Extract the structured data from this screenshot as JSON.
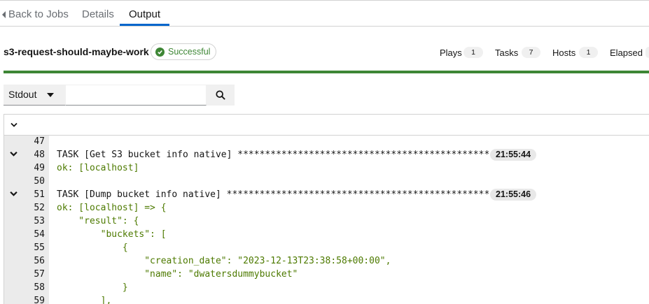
{
  "tabs": [
    {
      "label": "Back to Jobs"
    },
    {
      "label": "Details"
    },
    {
      "label": "Output"
    }
  ],
  "job": {
    "name": "s3-request-should-maybe-work",
    "status": "Successful"
  },
  "stats": [
    {
      "label": "Plays",
      "value": "1"
    },
    {
      "label": "Tasks",
      "value": "7"
    },
    {
      "label": "Hosts",
      "value": "1"
    },
    {
      "label": "Elapsed",
      "value": ""
    }
  ],
  "progress_fraction": 1.0,
  "colors": {
    "success": "#3e8635",
    "accent": "#0066cc",
    "ok_text": "#4d7a00"
  },
  "filter": {
    "selected": "Stdout",
    "search_value": "",
    "search_placeholder": ""
  },
  "output_lines": [
    {
      "num": "47",
      "text": "",
      "kind": "ok",
      "collapsible": false,
      "ts": ""
    },
    {
      "num": "48",
      "text": "TASK [Get S3 bucket info native] **********************************************",
      "kind": "task",
      "collapsible": true,
      "ts": "21:55:44"
    },
    {
      "num": "49",
      "text": "ok: [localhost]",
      "kind": "ok",
      "collapsible": false,
      "ts": ""
    },
    {
      "num": "50",
      "text": "",
      "kind": "ok",
      "collapsible": false,
      "ts": ""
    },
    {
      "num": "51",
      "text": "TASK [Dump bucket info native] ************************************************",
      "kind": "task",
      "collapsible": true,
      "ts": "21:55:46"
    },
    {
      "num": "52",
      "text": "ok: [localhost] => {",
      "kind": "ok",
      "collapsible": false,
      "ts": ""
    },
    {
      "num": "53",
      "text": "    \"result\": {",
      "kind": "ok",
      "collapsible": false,
      "ts": ""
    },
    {
      "num": "54",
      "text": "        \"buckets\": [",
      "kind": "ok",
      "collapsible": false,
      "ts": ""
    },
    {
      "num": "55",
      "text": "            {",
      "kind": "ok",
      "collapsible": false,
      "ts": ""
    },
    {
      "num": "56",
      "text": "                \"creation_date\": \"2023-12-13T23:38:58+00:00\",",
      "kind": "ok",
      "collapsible": false,
      "ts": ""
    },
    {
      "num": "57",
      "text": "                \"name\": \"dwatersdummybucket\"",
      "kind": "ok",
      "collapsible": false,
      "ts": ""
    },
    {
      "num": "58",
      "text": "            }",
      "kind": "ok",
      "collapsible": false,
      "ts": ""
    },
    {
      "num": "59",
      "text": "        ],",
      "kind": "ok",
      "collapsible": false,
      "ts": ""
    }
  ]
}
